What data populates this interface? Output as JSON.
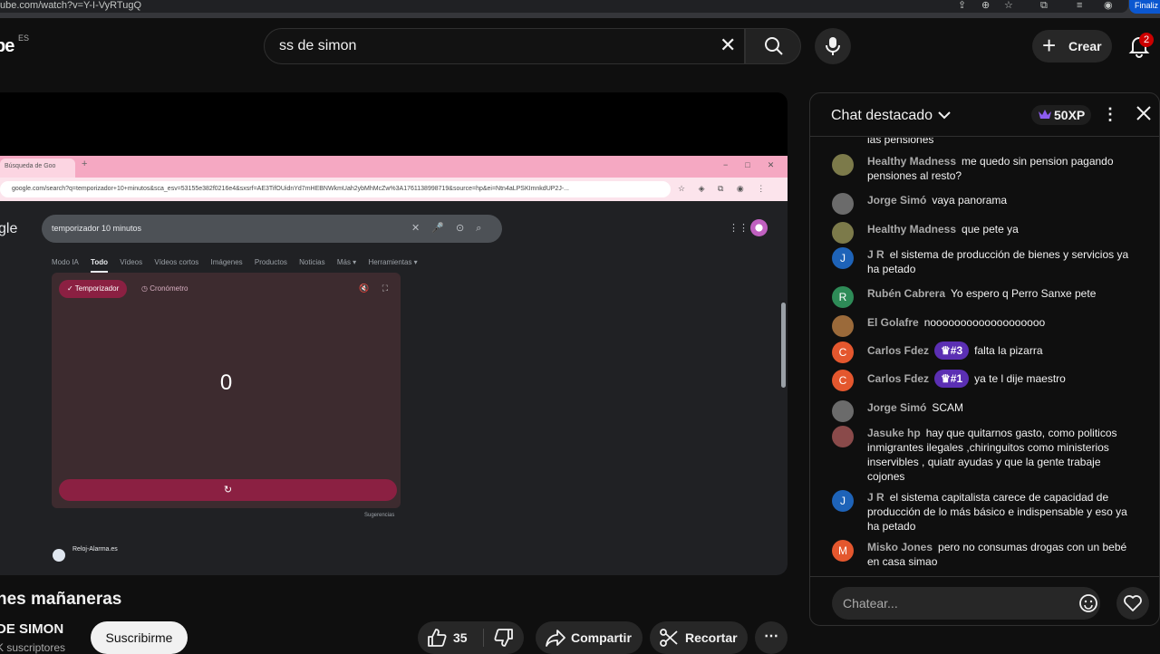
{
  "browser": {
    "url": "ube.com/watch?v=Y-I-VyRTugQ",
    "finalize_label": "Finaliz"
  },
  "header": {
    "logo": "be",
    "region": "ES",
    "search_value": "ss de simon",
    "create_label": "Crear",
    "notification_count": "2"
  },
  "video_content": {
    "tab_title": "Búsqueda de Goo",
    "address": "google.com/search?q=temporizador+10+minutos&sca_esv=53155e382f0216e4&sxsrf=AE3TifOUidnYd7mHEBNWkmUah2ybMhMcZw%3A1761138998719&source=hp&ei=Ntn4aLPSKImnkdUP2J-...",
    "google_logo": "gle",
    "google_query": "temporizador 10 minutos",
    "tabs": [
      "Modo IA",
      "Todo",
      "Vídeos",
      "Vídeos cortos",
      "Imágenes",
      "Productos",
      "Noticias",
      "Más ▾",
      "Herramientas ▾"
    ],
    "active_tab": "Todo",
    "timer_tab": "✓ Temporizador",
    "stopwatch_tab": "◷ Cronómetro",
    "timer_value": "0",
    "reset_symbol": "↻",
    "suggestions": "Sugerencias",
    "result_site": "Reloj-Alarma.es"
  },
  "video_info": {
    "title": "nes mañaneras",
    "channel": "DE SIMON",
    "subscribers": "K suscriptores",
    "subscribe_label": "Suscribirme",
    "likes": "35",
    "share_label": "Compartir",
    "clip_label": "Recortar"
  },
  "chat": {
    "title": "Chat destacado",
    "xp": "50XP",
    "partial_top": "las pensiones",
    "messages": [
      {
        "author": "Healthy Madness",
        "text": "me quedo sin pension pagando pensiones al resto?",
        "avatar_color": "#7c7a4a",
        "initial": "",
        "rank": ""
      },
      {
        "author": "Jorge Simó",
        "text": "vaya panorama",
        "avatar_color": "#6b6b6b",
        "initial": "",
        "rank": ""
      },
      {
        "author": "Healthy Madness",
        "text": "que pete ya",
        "avatar_color": "#7c7a4a",
        "initial": "",
        "rank": ""
      },
      {
        "author": "J R",
        "text": "el sistema de producción de bienes y servicios ya ha petado",
        "avatar_color": "#1e63b8",
        "initial": "J",
        "rank": ""
      },
      {
        "author": "Rubén Cabrera",
        "text": "Yo espero q Perro Sanxe pete",
        "avatar_color": "#2e8b57",
        "initial": "R",
        "rank": ""
      },
      {
        "author": "El Golafre",
        "text": "nooooooooooooooooooo",
        "avatar_color": "#9b6a3a",
        "initial": "",
        "rank": ""
      },
      {
        "author": "Carlos Fdez",
        "text": "falta la pizarra",
        "avatar_color": "#e4572e",
        "initial": "C",
        "rank": "#3"
      },
      {
        "author": "Carlos Fdez",
        "text": "ya te l dije maestro",
        "avatar_color": "#e4572e",
        "initial": "C",
        "rank": "#1"
      },
      {
        "author": "Jorge Simó",
        "text": "SCAM",
        "avatar_color": "#6b6b6b",
        "initial": "",
        "rank": ""
      },
      {
        "author": "Jasuke hp",
        "text": "hay que quitarnos gasto, como politicos inmigrantes ilegales ,chiringuitos como ministerios inservibles , quiatr ayudas y que la gente trabaje cojones",
        "avatar_color": "#8a4a4a",
        "initial": "",
        "rank": ""
      },
      {
        "author": "J R",
        "text": "el sistema capitalista carece de capacidad de producción de lo más básico e indispensable y eso ya ha petado",
        "avatar_color": "#1e63b8",
        "initial": "J",
        "rank": ""
      },
      {
        "author": "Misko Jones",
        "text": "pero no consumas drogas con un bebé en casa simao",
        "avatar_color": "#e4572e",
        "initial": "M",
        "rank": ""
      }
    ],
    "input_placeholder": "Chatear..."
  }
}
